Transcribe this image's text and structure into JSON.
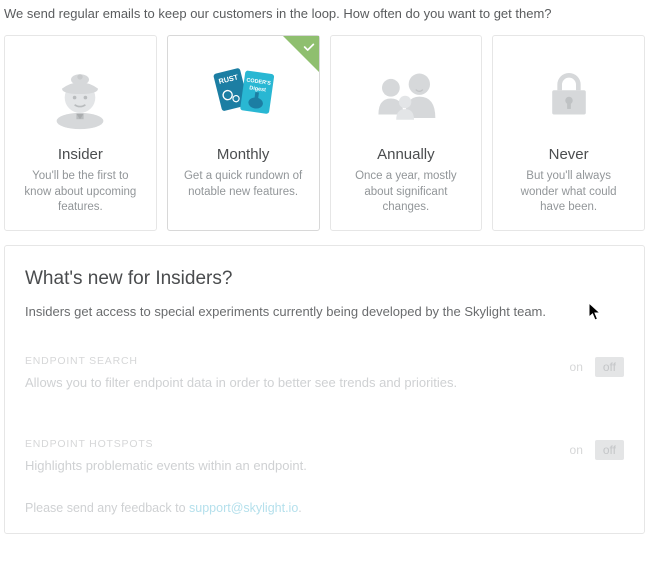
{
  "intro": "We send regular emails to keep our customers in the loop. How often do you want to get them?",
  "cards": {
    "insider": {
      "title": "Insider",
      "desc": "You'll be the first to know about upcoming features."
    },
    "monthly": {
      "title": "Monthly",
      "desc": "Get a quick rundown of notable new features.",
      "selected": true
    },
    "annually": {
      "title": "Annually",
      "desc": "Once a year, mostly about significant changes."
    },
    "never": {
      "title": "Never",
      "desc": "But you'll always wonder what could have been."
    }
  },
  "panel": {
    "title": "What's new for Insiders?",
    "subtitle": "Insiders get access to special experiments currently being developed by the Skylight team."
  },
  "features": {
    "endpoint_search": {
      "name": "ENDPOINT SEARCH",
      "desc": "Allows you to filter endpoint data in order to better see trends and priorities.",
      "on": "on",
      "off": "off"
    },
    "endpoint_hotspots": {
      "name": "ENDPOINT HOTSPOTS",
      "desc": "Highlights problematic events within an endpoint.",
      "on": "on",
      "off": "off"
    }
  },
  "feedback": {
    "prefix": "Please send any feedback to ",
    "email": "support@skylight.io",
    "suffix": "."
  }
}
